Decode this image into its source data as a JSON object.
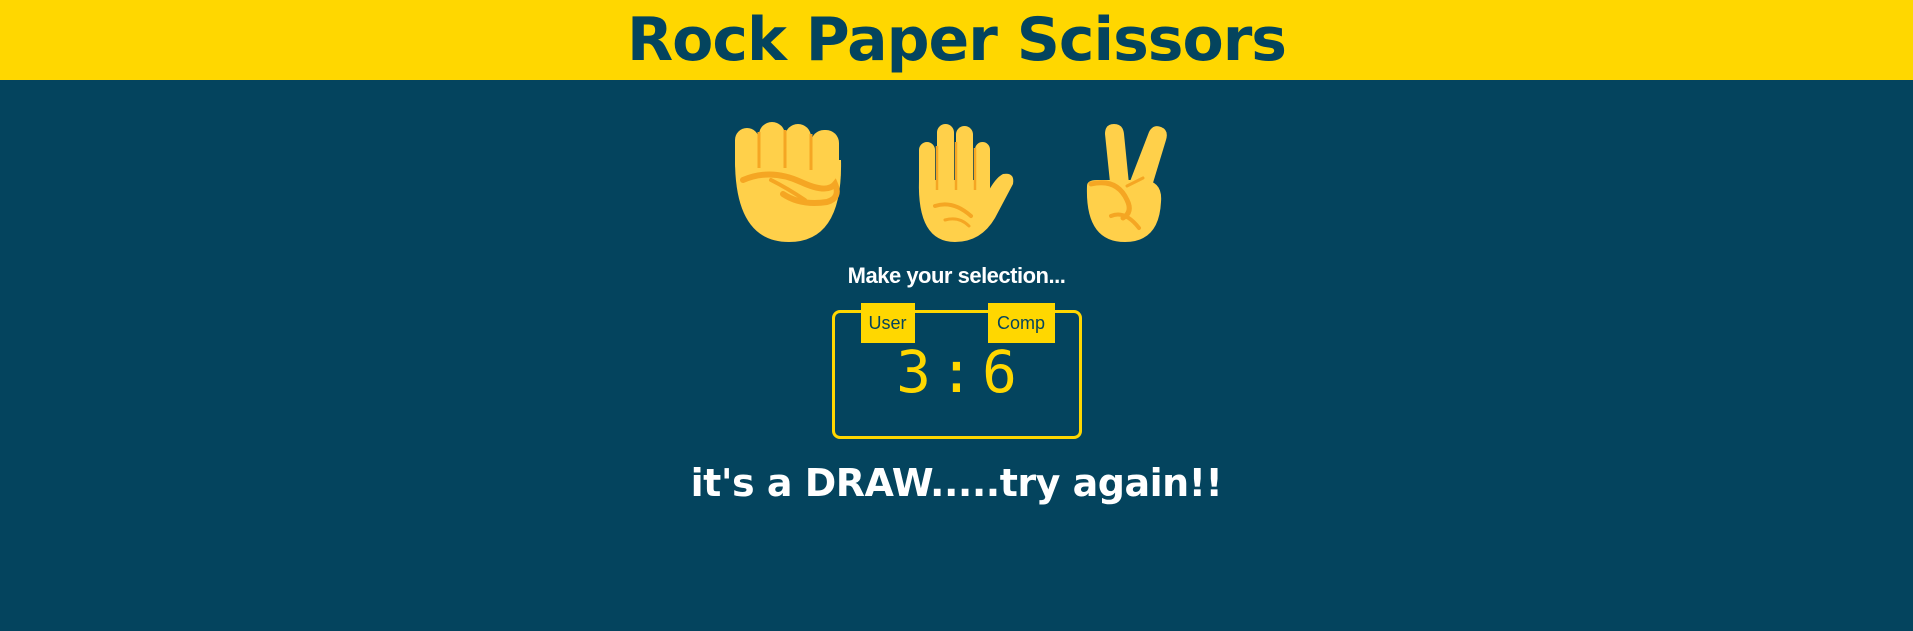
{
  "header": {
    "title": "Rock Paper Scissors"
  },
  "choices": [
    {
      "name": "rock",
      "icon": "raised-fist-icon"
    },
    {
      "name": "paper",
      "icon": "raised-hand-icon"
    },
    {
      "name": "scissors",
      "icon": "victory-hand-icon"
    }
  ],
  "prompt": "Make your selection...",
  "scoreboard": {
    "user_label": "User",
    "comp_label": "Comp",
    "user_score": "3",
    "separator": ":",
    "comp_score": "6"
  },
  "result": "it's a DRAW.....try again!!",
  "colors": {
    "background": "#04445e",
    "accent": "#ffd700",
    "text": "#ffffff",
    "hand": "#ffd04a",
    "hand_shade": "#f5a623"
  }
}
